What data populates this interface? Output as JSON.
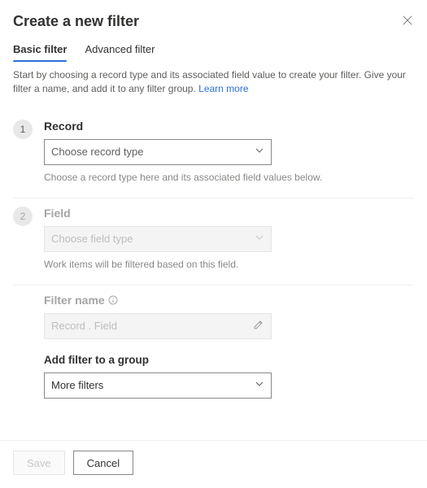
{
  "header": {
    "title": "Create a new filter"
  },
  "tabs": {
    "basic": "Basic filter",
    "advanced": "Advanced filter"
  },
  "intro": {
    "text_a": "Start by choosing a record type and its associated field value to create your filter. Give your filter a name, and add it to any filter group. ",
    "learn_more": "Learn more"
  },
  "step1": {
    "num": "1",
    "label": "Record",
    "placeholder": "Choose record type",
    "hint": "Choose a record type here and its associated field values below."
  },
  "step2": {
    "num": "2",
    "label": "Field",
    "placeholder": "Choose field type",
    "hint": "Work items will be filtered based on this field."
  },
  "filter_name": {
    "label": "Filter name",
    "placeholder": "Record . Field"
  },
  "group": {
    "label": "Add filter to a group",
    "value": "More filters"
  },
  "footer": {
    "save": "Save",
    "cancel": "Cancel"
  }
}
